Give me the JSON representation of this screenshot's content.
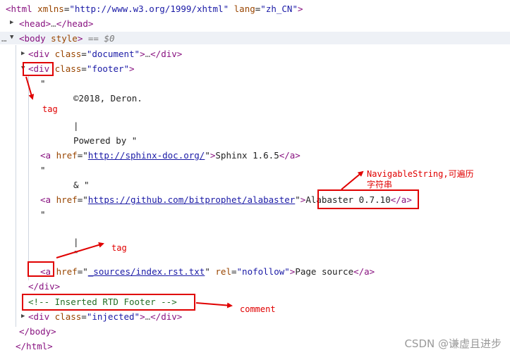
{
  "code": {
    "html_open": {
      "lt": "<",
      "tag": "html",
      "a1": "xmlns",
      "eq": "=",
      "v1": "\"http://www.w3.org/1999/xhtml\"",
      "a2": "lang",
      "v2": "\"zh_CN\"",
      "gt": ">"
    },
    "head": {
      "open": "<head>",
      "dots": "…",
      "close": "</head>"
    },
    "body_open": {
      "ellipsis": "…",
      "lt": "<",
      "tag": "body",
      "attr": "style",
      "gt": ">",
      "suffix": " == $0"
    },
    "div_document": {
      "lt": "<",
      "tag": "div",
      "attr": "class",
      "eq": "=",
      "val": "\"document\"",
      "gt": ">",
      "dots": "…",
      "close": "</div>"
    },
    "div_footer": {
      "lt": "<",
      "tag": "div",
      "attr": "class",
      "eq": "=",
      "val": "\"footer\"",
      "gt": ">"
    },
    "text": {
      "quote1": "\"",
      "copyright": "©2018, Deron.",
      "pipe1": "|",
      "powered": "Powered by \"",
      "quote2": "\"",
      "amp": "& \"",
      "quote3": "\"",
      "pipe2": "|",
      "quote4": "\""
    },
    "a_sphinx": {
      "lt": "<",
      "tag": "a",
      "attr": "href",
      "eq": "=\"",
      "url": "http://sphinx-doc.org/",
      "q": "\"",
      "gt": ">",
      "text": "Sphinx 1.6.5",
      "close": "</a>"
    },
    "a_alabaster": {
      "lt": "<",
      "tag": "a",
      "attr": "href",
      "eq": "=\"",
      "url": "https://github.com/bitprophet/alabaster",
      "q": "\"",
      "gt": ">",
      "text": "Alabaster 0.7.10",
      "close": "</a>"
    },
    "a_source": {
      "lt": "<",
      "tag": "a",
      "attr": "href",
      "eq": "=\"",
      "url": "_sources/index.rst.txt",
      "q": "\"",
      "attr2": "rel",
      "val2": "\"nofollow\"",
      "gt": ">",
      "text": "Page source",
      "close": "</a>"
    },
    "div_close": "</div>",
    "comment": "<!-- Inserted RTD Footer -->",
    "div_injected": {
      "lt": "<",
      "tag": "div",
      "attr": "class",
      "eq": "=",
      "val": "\"injected\"",
      "gt": ">",
      "dots": "…",
      "close": "</div>"
    },
    "body_close": "</body>",
    "html_close": "</html>"
  },
  "annotations": {
    "tag_label_1": "tag",
    "navigable_label_line1": "NavigableString,可遍历",
    "navigable_label_line2": "字符串",
    "tag_label_2": "tag",
    "comment_label": "comment"
  },
  "watermark": "CSDN @谦虚且进步",
  "colors": {
    "tag": "#881280",
    "attribute": "#994500",
    "value": "#1a1aa6",
    "comment": "#236e25",
    "annotation": "#e00000"
  }
}
